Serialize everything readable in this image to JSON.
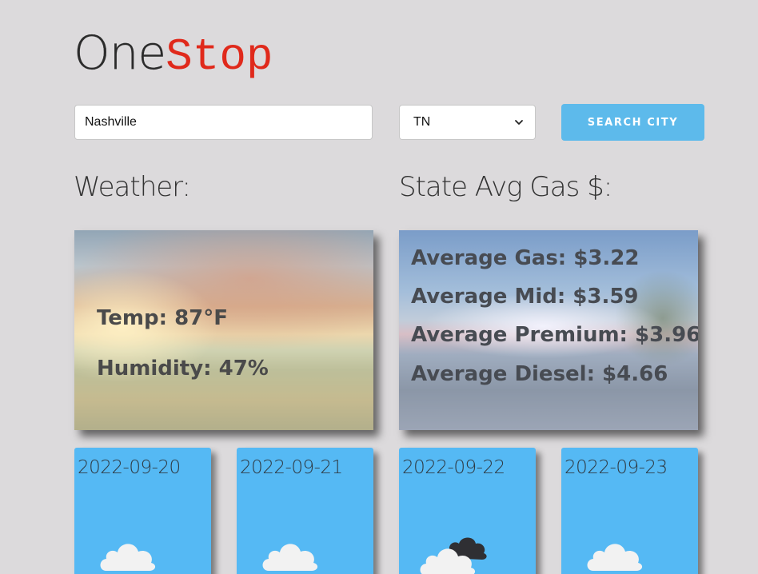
{
  "logo": {
    "part1": "One",
    "part2": "Stop",
    "part2_color": "#e0291b"
  },
  "search": {
    "city_value": "Nashville",
    "state_value": "TN",
    "button_label": "SEARCH CITY",
    "button_color": "#5dbaeb"
  },
  "weather": {
    "title": "Weather:",
    "temp": "Temp: 87°F",
    "humidity": "Humidity: 47%"
  },
  "gas": {
    "title": "State Avg Gas $:",
    "average": "Average Gas: $3.22",
    "mid": "Average Mid: $3.59",
    "premium": "Average Premium: $3.96",
    "diesel": "Average Diesel: $4.66"
  },
  "forecast": [
    {
      "date": "2022-09-20",
      "icon": "cloud-icon"
    },
    {
      "date": "2022-09-21",
      "icon": "cloud-icon"
    },
    {
      "date": "2022-09-22",
      "icon": "dark-clouds-icon"
    },
    {
      "date": "2022-09-23",
      "icon": "cloud-icon"
    }
  ],
  "colors": {
    "background": "#dcdadc",
    "forecast_card": "#55b9f4"
  }
}
